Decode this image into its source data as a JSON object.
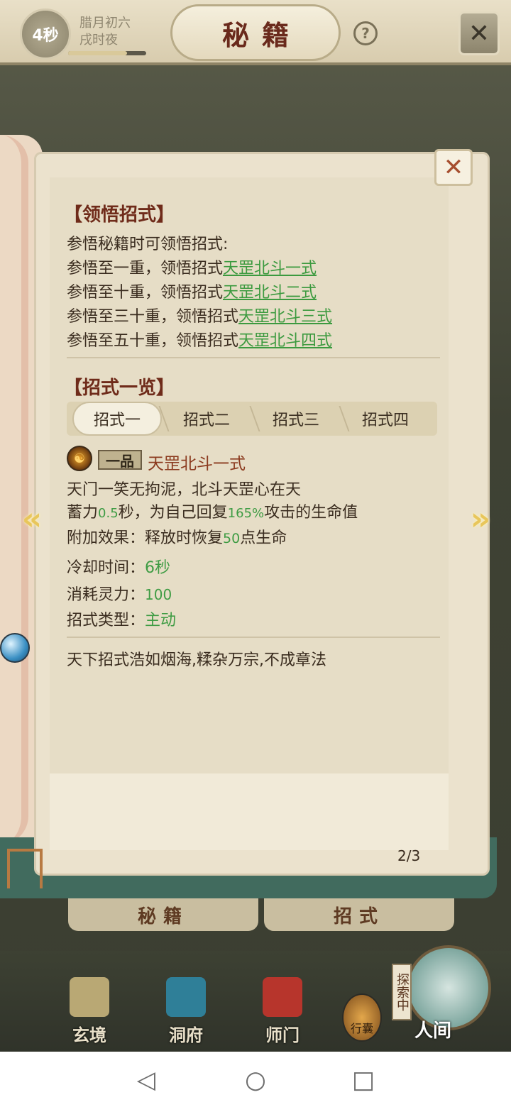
{
  "top": {
    "timer": "4秒",
    "date_line1": "腊月初六",
    "date_line2": "戌时夜",
    "title": "秘籍",
    "help": "?",
    "close": "✕"
  },
  "comprehend": {
    "title": "【领悟招式】",
    "intro": "参悟秘籍时可领悟招式:",
    "rows": [
      {
        "prefix": "参悟至一重，领悟招式",
        "link": "天罡北斗一式"
      },
      {
        "prefix": "参悟至十重，领悟招式",
        "link": "天罡北斗二式"
      },
      {
        "prefix": "参悟至三十重，领悟招式",
        "link": "天罡北斗三式"
      },
      {
        "prefix": "参悟至五十重，领悟招式",
        "link": "天罡北斗四式"
      }
    ]
  },
  "moves": {
    "title": "【招式一览】",
    "tabs": [
      "招式一",
      "招式二",
      "招式三",
      "招式四"
    ],
    "grade": "一品",
    "name": "天罡北斗一式",
    "poem": "天门一笑无拘泥，北斗天罡心在天",
    "effect_a": "蓄力",
    "effect_b": "0.5",
    "effect_c": "秒，为自己回复",
    "effect_d": "165%",
    "effect_e": "攻击的生命值",
    "extra_a": "附加效果：释放时恢复",
    "extra_b": "50",
    "extra_c": "点生命",
    "cooldown_label": "冷却时间：",
    "cooldown_value": "6秒",
    "cost_label": "消耗灵力：",
    "cost_value": "100",
    "type_label": "招式类型：",
    "type_value": "主动",
    "footer": "天下招式浩如烟海,糅杂万宗,不成章法"
  },
  "page_num": "2/3",
  "subtabs": [
    "秘籍",
    "招式"
  ],
  "nav": [
    {
      "label": "玄境",
      "color": "#b9a874"
    },
    {
      "label": "洞府",
      "color": "#2f7f98"
    },
    {
      "label": "师门",
      "color": "#b7352c"
    }
  ],
  "bag": "行囊",
  "explore": "探索中",
  "world": "人间",
  "icons": [
    "help-icon",
    "close-icon",
    "skill-icon",
    "arrow-left-icon",
    "arrow-right-icon",
    "back-icon",
    "home-icon",
    "recents-icon"
  ]
}
